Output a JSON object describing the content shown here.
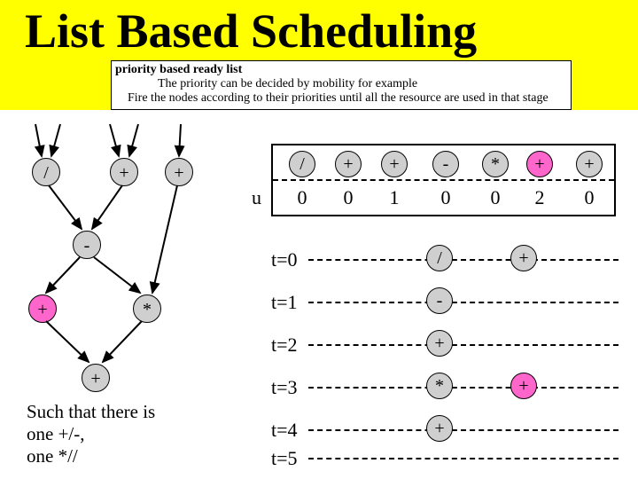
{
  "title": "List Based Scheduling",
  "description": {
    "heading": "priority based ready list",
    "line2": "The priority can be decided by mobility for example",
    "line3": "Fire the nodes according to their priorities until all the resource are used in that stage"
  },
  "dag": {
    "n1": "/",
    "n2": "+",
    "n3": "+",
    "n4": "-",
    "n5": "+",
    "n6": "*",
    "n7": "+"
  },
  "table": {
    "u_label": "u",
    "cols": [
      {
        "op": "/",
        "u": "0",
        "cls": "gray"
      },
      {
        "op": "+",
        "u": "0",
        "cls": "gray"
      },
      {
        "op": "+",
        "u": "1",
        "cls": "gray"
      },
      {
        "op": "-",
        "u": "0",
        "cls": "gray"
      },
      {
        "op": "*",
        "u": "0",
        "cls": "gray"
      },
      {
        "op": "+",
        "u": "2",
        "cls": "pink"
      },
      {
        "op": "+",
        "u": "0",
        "cls": "gray"
      }
    ]
  },
  "timeline": {
    "rows": [
      {
        "label": "t=0",
        "a": {
          "op": "/",
          "cls": "gray"
        },
        "b": {
          "op": "+",
          "cls": "gray"
        }
      },
      {
        "label": "t=1",
        "a": {
          "op": "-",
          "cls": "gray"
        },
        "b": null
      },
      {
        "label": "t=2",
        "a": {
          "op": "+",
          "cls": "gray"
        },
        "b": null
      },
      {
        "label": "t=3",
        "a": {
          "op": "*",
          "cls": "gray"
        },
        "b": {
          "op": "+",
          "cls": "pink"
        }
      },
      {
        "label": "t=4",
        "a": {
          "op": "+",
          "cls": "gray"
        },
        "b": null
      },
      {
        "label": "t=5",
        "a": null,
        "b": null
      }
    ]
  },
  "caption": {
    "l1": "Such that there is",
    "l2": " one +/-,",
    "l3": " one *//"
  },
  "chart_data": {
    "type": "table",
    "title": "List Based Scheduling",
    "dag_edges": [
      [
        "in1",
        "/"
      ],
      [
        "in2",
        "/"
      ],
      [
        "in3",
        "+a"
      ],
      [
        "in4",
        "+a"
      ],
      [
        "in5",
        "+b"
      ],
      [
        "/",
        "-"
      ],
      [
        "+a",
        "-"
      ],
      [
        "+b",
        "*"
      ],
      [
        "-",
        "+c"
      ],
      [
        "-",
        "*"
      ],
      [
        "+c",
        "+d"
      ],
      [
        "*",
        "+d"
      ]
    ],
    "mobility_u": {
      "/": 0,
      "+a": 0,
      "+b": 1,
      "-": 0,
      "*": 0,
      "+c": 2,
      "+d": 0
    },
    "schedule": {
      "resources": {
        "adder_sub": 1,
        "mul_div": 1
      },
      "t0": [
        "/",
        "+"
      ],
      "t1": [
        "-"
      ],
      "t2": [
        "+"
      ],
      "t3": [
        "*",
        "+"
      ],
      "t4": [
        "+"
      ],
      "t5": []
    }
  }
}
